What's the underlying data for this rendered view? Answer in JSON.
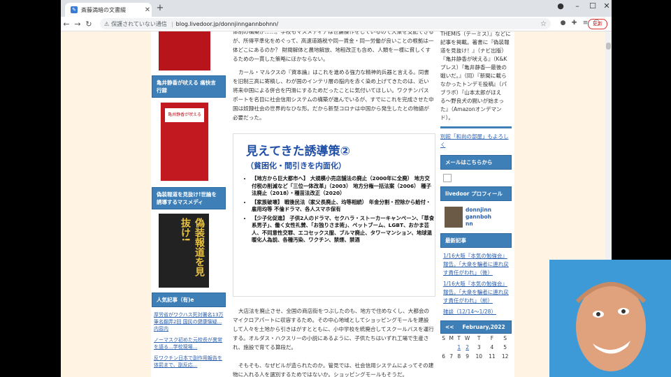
{
  "browser": {
    "tab_title": "斎藤満暗の文書綴",
    "url": "blog.livedoor.jp/donnjinngannbohnn/",
    "insecure_label": "保護されていない通信",
    "update_label": "更新"
  },
  "left": {
    "book1_title": "亀井静香が吠える",
    "head1": "亀井静香が吠える 痛快言行録",
    "book2_title": "偽装報道を見抜け!",
    "head2": "偽装報道を見抜け!世論を誘導するマスメディ",
    "head3": "人気記事（有)e",
    "links": [
      "厚労省がワクハス死対署名13万筆名翻弄2回 国民の健康懐疑... 内容内",
      "ノーマスク初めた元校長が異常を語る...学校現場...",
      "反ワクチン日本で副作用報告を体罰まで、副反応..."
    ]
  },
  "article": {
    "p1": "体制の構築が……。学校もマスメディアは世論操作をしているので大衆を支配できるが、所得平準化をめぐって、高速道路税や同一賃金・同一労働が良いことの根拠は一体どこにあるのか？ 財閥解体と農地解放、地租改正も含め、人類を一様に貧しくするための一貫した策略にほかならない。",
    "p2": "カール・マルクスの『資本論』はこれを進める強力な精神的兵器と言える。同書を旧制三高に寄稿し、わが国のインテリ層の脳内を赤く染め上げてきたのは、近い将来中国による併合を円滑にするためだったことに気付いてほしい。ワクチンパスポートを名目に社会信用システムの構築が進んでいるが、すでにこれを完成させた中国は奴隷社会の世界的なひな形。だから新型コロナは中国から発生したとの物語が必要だった。",
    "slide_title": "見えてきた誘導策②",
    "slide_sub": "（貧困化・間引きを内面化）",
    "slide_items": [
      "【地方から巨大都市へ】 大規模小売店舗法の廃止（2000年に全廃） 地方交付税の削減など「三位一体改革」（2003） 地方分権一括法案（2006） 種子法廃止（2018）・種苗法改正（2020）",
      "【家族破壊】 戦後民法（家父長廃止、均等相続） 年金分割・控除から給付・雇用均等 不倫ドラマ、各人スマホ保有",
      "【少子化促進】 子供2人のドラマ、セクハラ・ストーカーキャンペーン、「草食系男子」、働く女性礼賛、「お独りさま術」、ペットブーム、LGBT、おかま芸人、不同意性交罪、エコセックス服、ブルマ廃止、タワーマンション、地球温暖化人為説、各種汚染、ワクチン、禁煙、禁酒"
    ],
    "p3": "大店法を廃止させ、全国の商店街をつぶしたのも、地方で住めなくし、大都会のマイクロアパートに収容するため。その中心地域としてショッピングモールを建設して人々を土地から引きはがすとともに、小中学校を統廃合してスクールバスを運行する。オルダス・ハクスリーの小説にあるように、子供たちはいずれ工場で生産され、施設で育てる算段だ。",
    "p4": "そもそも、なぜビルが造られたのか。管見では、社会信用システムによってその建物に入れる人を選別するためではないか。ショッピングモールもそうだ。"
  },
  "right": {
    "intro": "THEMIS（テーミス）』などに記事を掲載。著書に『偽装報道を見抜け！』（ナビ出版）『亀井静香が吠える』（K&Kプレス）『亀井静香―最後の戦いだ。』（同）『新聞に載らなかったトンデモ投稿』（パブラボ）『山本太郎がほえる〜野良犬の闘いが始まった』（Amazonオンデマンド）。",
    "link1": "別館「和尚の部屋」もよろしく",
    "head_mail": "メールはこちらから",
    "head_profile": "livedoor プロフィール",
    "profile_name": "donnjinngannbohnn",
    "head_recent": "最新記事",
    "recent": [
      "1/16大阪『本気の勉強会』報告。「大衆を騙者に連れ戻す責任がわれ」（後）",
      "1/16大阪『本気の勉強会』報告。「大衆を騙者に連れ戻す責任がわれ」（前）",
      "雑談（12/14〜1/28）"
    ],
    "calendar_title": "February,2022",
    "calendar_prev": "<<",
    "calendar_days": [
      "S",
      "M",
      "T",
      "W",
      "T",
      "F",
      "S"
    ],
    "calendar_rows": [
      [
        "",
        "",
        "1",
        "2",
        "3",
        "4",
        "5"
      ],
      [
        "6",
        "7",
        "8",
        "9",
        "10",
        "11",
        "12"
      ]
    ]
  }
}
